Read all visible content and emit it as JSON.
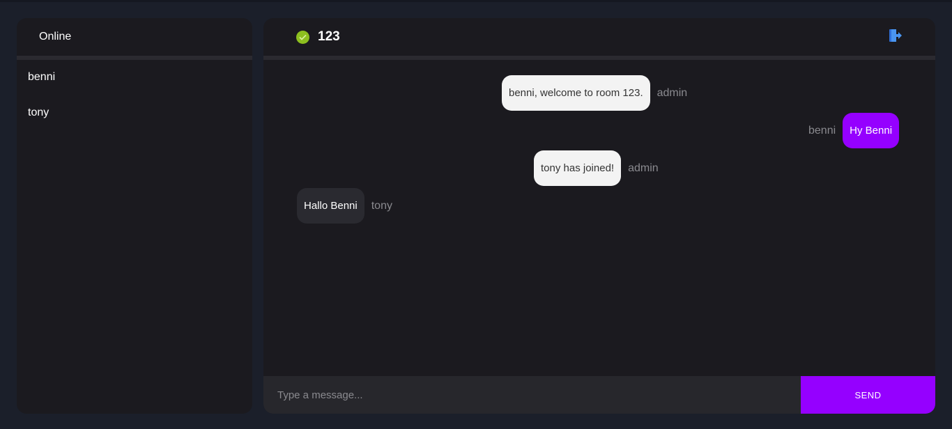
{
  "sidebar": {
    "title": "Online",
    "users": [
      {
        "name": "benni"
      },
      {
        "name": "tony"
      }
    ]
  },
  "chat": {
    "room": "123",
    "status_icon": "online-check-icon",
    "leave_icon": "exit-door-icon",
    "accent_color": "#9500ff",
    "status_color": "#8dbf1f",
    "messages": [
      {
        "text": "benni, welcome to room 123.",
        "sender": "admin",
        "kind": "system"
      },
      {
        "text": "Hy Benni",
        "sender": "benni",
        "kind": "own"
      },
      {
        "text": "tony has joined!",
        "sender": "admin",
        "kind": "system"
      },
      {
        "text": "Hallo Benni",
        "sender": "tony",
        "kind": "other"
      }
    ]
  },
  "composer": {
    "placeholder": "Type a message...",
    "value": "",
    "send_label": "SEND"
  }
}
